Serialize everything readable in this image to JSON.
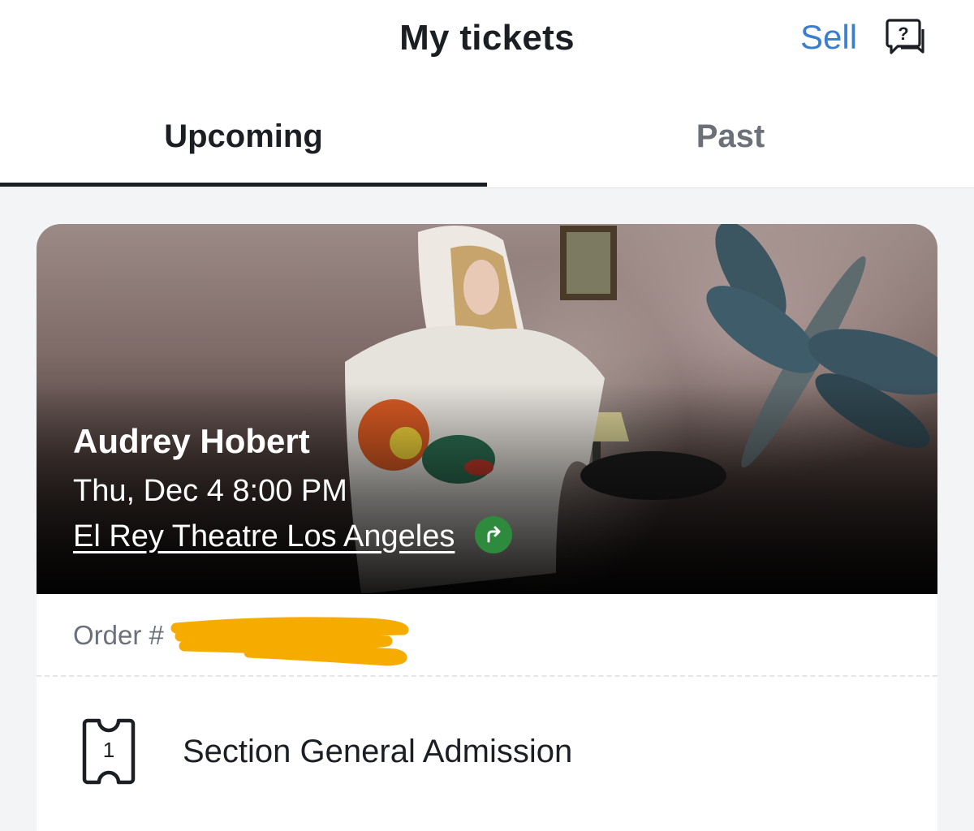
{
  "header": {
    "title": "My tickets",
    "sell_label": "Sell",
    "help_icon": "help-chat-icon"
  },
  "tabs": [
    {
      "label": "Upcoming",
      "active": true
    },
    {
      "label": "Past",
      "active": false
    }
  ],
  "event": {
    "artist": "Audrey Hobert",
    "datetime": "Thu, Dec 4 8:00 PM",
    "venue": "El Rey Theatre Los Angeles",
    "directions_icon": "directions-arrow-icon",
    "order_label": "Order #",
    "order_number_redacted": true,
    "ticket_count": "1",
    "section": "Section General Admission"
  },
  "colors": {
    "accent": "#3a7fcf",
    "text": "#1b1f24",
    "muted": "#6b7079",
    "directions": "#2e8b3e",
    "redaction": "#f5ab00",
    "background": "#f3f4f6"
  }
}
